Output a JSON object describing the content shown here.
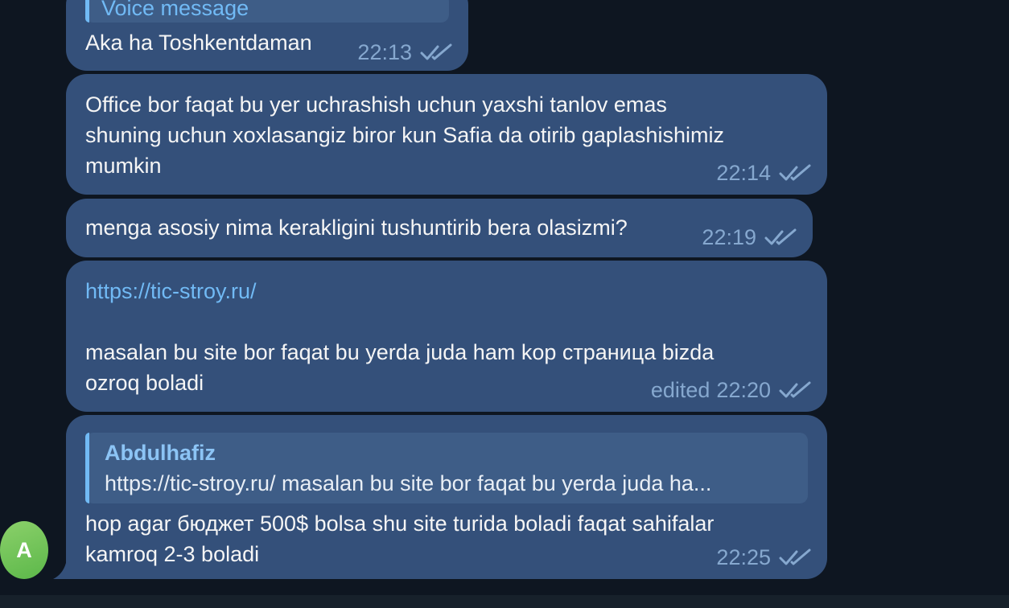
{
  "messages": [
    {
      "quote_label": "Voice message",
      "text": "Aka ha Toshkentdaman",
      "time": "22:13"
    },
    {
      "text": "Office bor faqat bu yer uchrashish uchun yaxshi tanlov emas\nshuning uchun xoxlasangiz biror kun Safia da otirib gaplashishimiz\nmumkin",
      "time": "22:14"
    },
    {
      "text": "menga asosiy nima kerakligini tushuntirib bera olasizmi?",
      "time": "22:19"
    },
    {
      "link": "https://tic-stroy.ru/",
      "text": "masalan bu site bor faqat bu yerda juda ham kop страница bizda\nozroq boladi",
      "edited_label": "edited",
      "time": "22:20"
    },
    {
      "reply_author": "Abdulhafiz",
      "reply_text": "https://tic-stroy.ru/  masalan bu site bor faqat bu yerda juda ha...",
      "text": "hop agar бюджет 500$ bolsa shu site turida boladi faqat sahifalar\nkamroq 2-3 boladi",
      "time": "22:25"
    }
  ],
  "sender": {
    "avatar_letter": "A"
  },
  "colors": {
    "background": "#0e1621",
    "bubble": "#34507a",
    "meta": "#86a8cf",
    "link": "#71baf5",
    "avatar": "#6cc152"
  },
  "icons": {
    "read_status": "double-check-icon"
  }
}
